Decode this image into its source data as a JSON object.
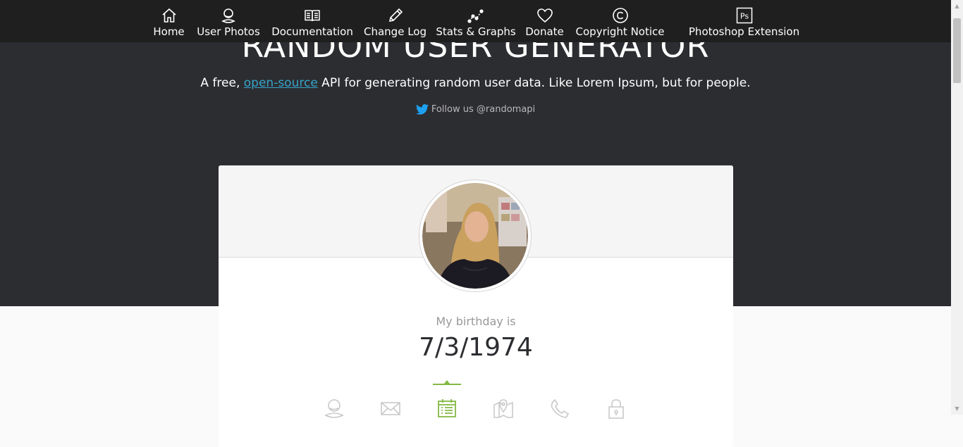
{
  "nav": {
    "items": [
      {
        "label": "Home",
        "icon": "home-icon"
      },
      {
        "label": "User Photos",
        "icon": "user-photos-icon"
      },
      {
        "label": "Documentation",
        "icon": "book-icon"
      },
      {
        "label": "Change Log",
        "icon": "pencil-icon"
      },
      {
        "label": "Stats & Graphs",
        "icon": "graph-icon"
      },
      {
        "label": "Donate",
        "icon": "heart-icon"
      },
      {
        "label": "Copyright Notice",
        "icon": "copyright-icon"
      },
      {
        "label": "Photoshop Extension",
        "icon": "photoshop-icon"
      }
    ]
  },
  "hero": {
    "title": "RANDOM USER GENERATOR",
    "tagline_prefix": "A free, ",
    "tagline_link": "open-source",
    "tagline_suffix": " API for generating random user data. Like Lorem Ipsum, but for people.",
    "follow_text": "Follow us @randomapi"
  },
  "card": {
    "info_label": "My birthday is",
    "info_value": "7/3/1974",
    "active_tab": "birthday",
    "tabs": [
      {
        "name": "name",
        "icon": "user-icon"
      },
      {
        "name": "email",
        "icon": "envelope-icon"
      },
      {
        "name": "birthday",
        "icon": "calendar-icon"
      },
      {
        "name": "location",
        "icon": "map-icon"
      },
      {
        "name": "phone",
        "icon": "phone-icon"
      },
      {
        "name": "password",
        "icon": "lock-icon"
      }
    ]
  },
  "colors": {
    "hero_bg": "#2c2d31",
    "navbar_bg": "#1f1f1f",
    "accent_green": "#83ba43",
    "link_blue": "#36a4c9",
    "twitter_blue": "#1da1f2",
    "icon_grey": "#c9c9c9"
  }
}
